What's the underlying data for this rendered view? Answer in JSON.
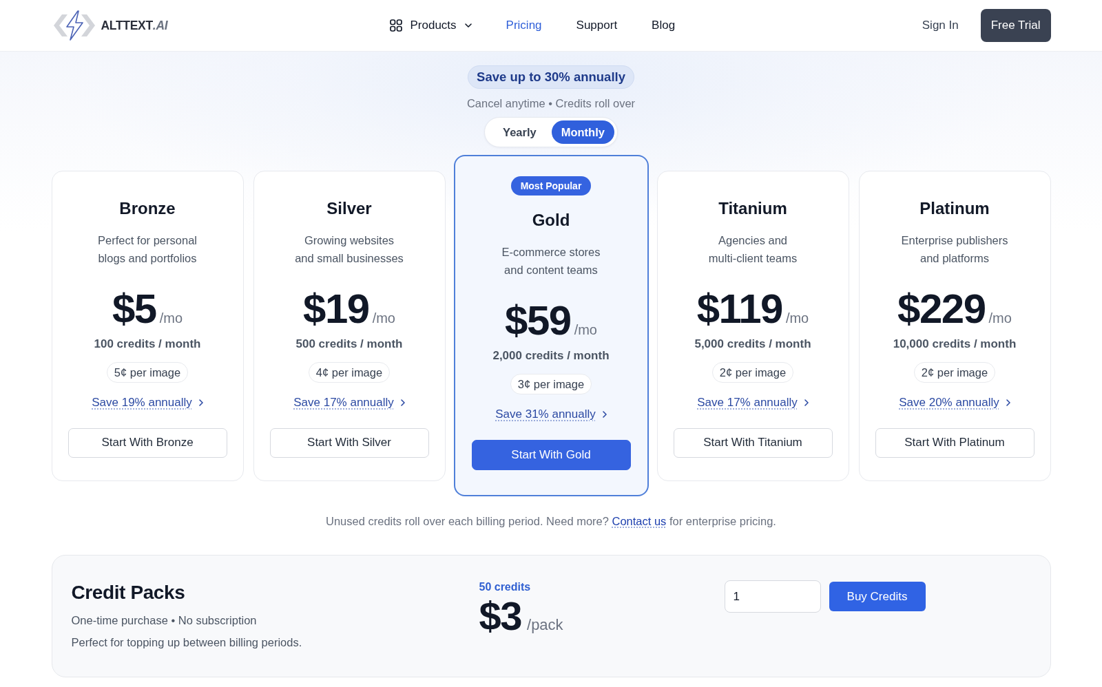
{
  "header": {
    "logo": {
      "name": "ALTTEXT",
      "suffix": ".AI"
    },
    "nav": [
      {
        "label": "Products",
        "kind": "menu",
        "selected": false
      },
      {
        "label": "Pricing",
        "kind": "link",
        "selected": true
      },
      {
        "label": "Support",
        "kind": "link",
        "selected": false
      },
      {
        "label": "Blog",
        "kind": "link",
        "selected": false
      }
    ],
    "sign_in": "Sign In",
    "cta": "Free Trial"
  },
  "hero": {
    "badge": "Save up to 30% annually",
    "subtitle": "Cancel anytime • Credits roll over",
    "billing_toggle": [
      {
        "label": "Yearly",
        "selected": false
      },
      {
        "label": "Monthly",
        "selected": true
      }
    ]
  },
  "plans": [
    {
      "name": "Bronze",
      "featured": false,
      "description": [
        "Perfect for personal",
        "blogs and portfolios"
      ],
      "price": "$5",
      "period": "/mo",
      "credits": "100 credits / month",
      "per_image": "5¢ per image",
      "save_link": "Save 19% annually",
      "button": "Start With Bronze"
    },
    {
      "name": "Silver",
      "featured": false,
      "description": [
        "Growing websites",
        "and small businesses"
      ],
      "price": "$19",
      "period": "/mo",
      "credits": "500 credits / month",
      "per_image": "4¢ per image",
      "save_link": "Save 17% annually",
      "button": "Start With Silver"
    },
    {
      "name": "Gold",
      "featured": true,
      "badge": "Most Popular",
      "description": [
        "E-commerce stores",
        "and content teams"
      ],
      "price": "$59",
      "period": "/mo",
      "credits": "2,000 credits / month",
      "per_image": "3¢ per image",
      "save_link": "Save 31% annually",
      "button": "Start With Gold"
    },
    {
      "name": "Titanium",
      "featured": false,
      "description": [
        "Agencies and",
        "multi-client teams"
      ],
      "price": "$119",
      "period": "/mo",
      "credits": "5,000 credits / month",
      "per_image": "2¢ per image",
      "save_link": "Save 17% annually",
      "button": "Start With Titanium"
    },
    {
      "name": "Platinum",
      "featured": false,
      "description": [
        "Enterprise publishers",
        "and platforms"
      ],
      "price": "$229",
      "period": "/mo",
      "credits": "10,000 credits / month",
      "per_image": "2¢ per image",
      "save_link": "Save 20% annually",
      "button": "Start With Platinum"
    }
  ],
  "note": {
    "text": "Unused credits roll over each billing period. Need more?",
    "link": "Contact us",
    "text_after": "for enterprise pricing."
  },
  "credit_packs": {
    "title": "Credit Packs",
    "subtitle": "One-time purchase • No subscription",
    "description": "Perfect for topping up between billing periods.",
    "pack_credits": "50 credits",
    "price": "$3",
    "period": "/pack",
    "quantity": "1",
    "button": "Buy Credits"
  }
}
